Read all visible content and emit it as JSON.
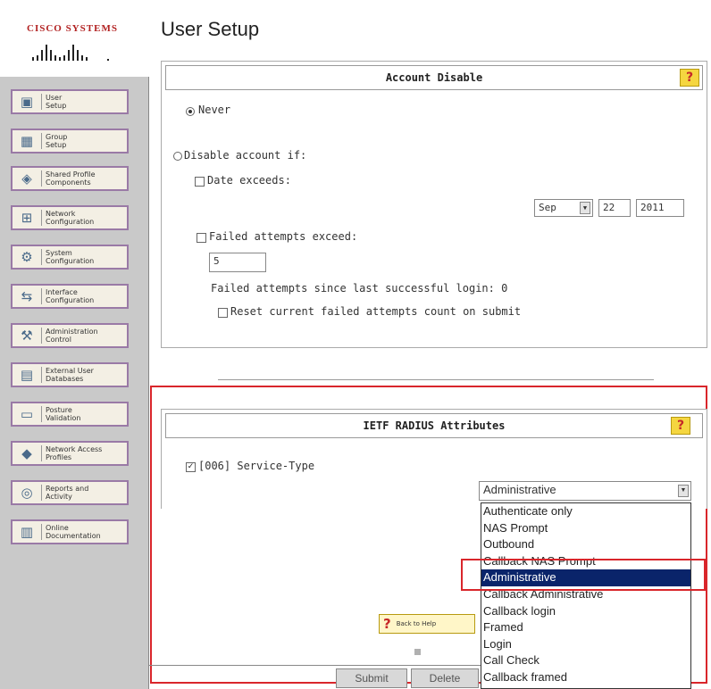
{
  "logo": {
    "text": "CISCO SYSTEMS"
  },
  "page_title": "User Setup",
  "nav": [
    {
      "label": "User\nSetup",
      "icon": "user-setup-icon"
    },
    {
      "label": "Group\nSetup",
      "icon": "group-setup-icon"
    },
    {
      "label": "Shared Profile\nComponents",
      "icon": "shared-profile-icon"
    },
    {
      "label": "Network\nConfiguration",
      "icon": "network-config-icon"
    },
    {
      "label": "System\nConfiguration",
      "icon": "system-config-icon"
    },
    {
      "label": "Interface\nConfiguration",
      "icon": "interface-config-icon"
    },
    {
      "label": "Administration\nControl",
      "icon": "admin-control-icon"
    },
    {
      "label": "External User\nDatabases",
      "icon": "external-db-icon"
    },
    {
      "label": "Posture\nValidation",
      "icon": "posture-validation-icon"
    },
    {
      "label": "Network Access\nProfiles",
      "icon": "network-access-icon"
    },
    {
      "label": "Reports and\nActivity",
      "icon": "reports-icon"
    },
    {
      "label": "Online\nDocumentation",
      "icon": "documentation-icon"
    }
  ],
  "account_disable": {
    "title": "Account Disable",
    "never": "Never",
    "disable_if": "Disable account if:",
    "date_exceeds": "Date exceeds:",
    "month": "Sep",
    "day": "22",
    "year": "2011",
    "failed_exceed": "Failed attempts exceed:",
    "failed_value": "5",
    "failed_since": "Failed attempts since last successful login: 0",
    "reset_label": "Reset current failed attempts count on submit"
  },
  "ietf": {
    "title": "IETF RADIUS Attributes",
    "service_type": "[006] Service-Type",
    "selected": "Administrative",
    "options": [
      "Authenticate only",
      "NAS Prompt",
      "Outbound",
      "Callback NAS Prompt",
      "Administrative",
      "Callback Administrative",
      "Callback login",
      "Framed",
      "Login",
      "Call Check",
      "Callback framed"
    ],
    "selected_index": 4
  },
  "back_to_help": "Back to Help",
  "buttons": {
    "submit": "Submit",
    "delete": "Delete"
  },
  "colors": {
    "highlight_red": "#d9262b",
    "selection_blue": "#0a246a",
    "help_yellow": "#f5d640"
  }
}
